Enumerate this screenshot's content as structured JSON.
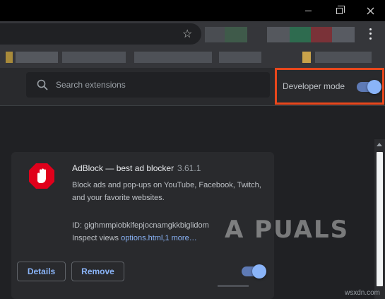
{
  "extensions_header": {
    "search_placeholder": "Search extensions",
    "developer_mode_label": "Developer mode",
    "developer_mode_on": true
  },
  "extension_card": {
    "name": "AdBlock — best ad blocker",
    "version": "3.61.1",
    "description": "Block ads and pop-ups on YouTube, Facebook, Twitch, and your favorite websites.",
    "id_text": "ID: gighmmpiobklfepjocnamgkkbiglidom",
    "inspect_label": "Inspect views",
    "inspect_link": "options.html,1 more…",
    "details_label": "Details",
    "remove_label": "Remove",
    "enabled": true
  },
  "watermark": {
    "text": "A  PUALS",
    "site": "wsxdn.com"
  },
  "colors": {
    "accent": "#8ab4f8",
    "highlight": "#e8471c",
    "adblock_red": "#e0001b"
  },
  "icons": {
    "search": "search-icon",
    "star": "bookmark-star-icon",
    "menu": "more-vert-icon"
  }
}
